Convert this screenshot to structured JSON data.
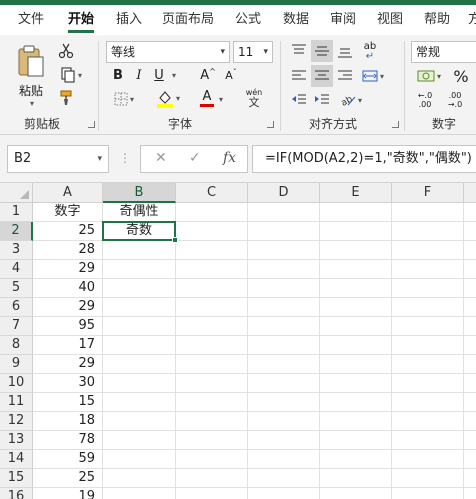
{
  "tabs": [
    "文件",
    "开始",
    "插入",
    "页面布局",
    "公式",
    "数据",
    "审阅",
    "视图",
    "帮助",
    "方"
  ],
  "active_tab_index": 1,
  "ribbon": {
    "clipboard": {
      "paste_label": "粘贴",
      "group_label": "剪贴板",
      "cut_icon": "scissors-icon",
      "copy_icon": "copy-icon",
      "format_painter_icon": "brush-icon"
    },
    "font": {
      "font_name": "等线",
      "font_size": "11",
      "bold": "B",
      "italic": "I",
      "underline": "U",
      "grow_font": "A",
      "shrink_font": "A",
      "font_color": "A",
      "phonetic": "wén",
      "group_label": "字体"
    },
    "alignment": {
      "wrap_icon": "ab",
      "group_label": "对齐方式"
    },
    "number": {
      "format": "常规",
      "percent": "%",
      "group_label": "数字"
    }
  },
  "formula_bar": {
    "name_box": "B2",
    "fx": "fx",
    "cancel": "✕",
    "enter": "✓",
    "formula": "=IF(MOD(A2,2)=1,\"奇数\",\"偶数\")"
  },
  "sheet": {
    "columns": [
      "A",
      "B",
      "C",
      "D",
      "E",
      "F"
    ],
    "selected_cell": "B2",
    "rows": [
      {
        "num": "1",
        "a": "数字",
        "b": "奇偶性"
      },
      {
        "num": "2",
        "a": "25",
        "b": "奇数"
      },
      {
        "num": "3",
        "a": "28",
        "b": ""
      },
      {
        "num": "4",
        "a": "29",
        "b": ""
      },
      {
        "num": "5",
        "a": "40",
        "b": ""
      },
      {
        "num": "6",
        "a": "29",
        "b": ""
      },
      {
        "num": "7",
        "a": "95",
        "b": ""
      },
      {
        "num": "8",
        "a": "17",
        "b": ""
      },
      {
        "num": "9",
        "a": "29",
        "b": ""
      },
      {
        "num": "10",
        "a": "30",
        "b": ""
      },
      {
        "num": "11",
        "a": "15",
        "b": ""
      },
      {
        "num": "12",
        "a": "18",
        "b": ""
      },
      {
        "num": "13",
        "a": "78",
        "b": ""
      },
      {
        "num": "14",
        "a": "59",
        "b": ""
      },
      {
        "num": "15",
        "a": "25",
        "b": ""
      },
      {
        "num": "16",
        "a": "19",
        "b": ""
      }
    ]
  },
  "colors": {
    "accent": "#217346",
    "selected_header_text": "#185c37"
  }
}
